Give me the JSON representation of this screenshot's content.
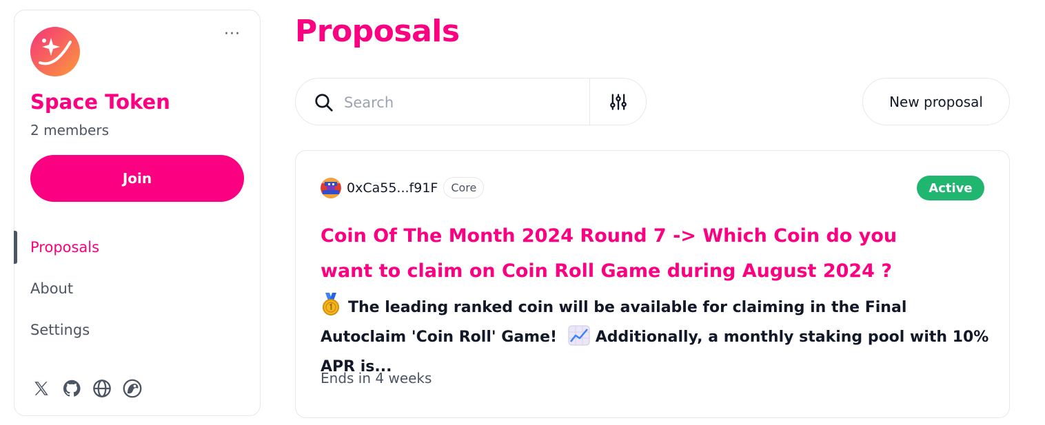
{
  "space": {
    "name": "Space Token",
    "members": "2 members",
    "join_label": "Join",
    "more_label": "···",
    "logo_icon": "space-token-logo",
    "nav": [
      {
        "label": "Proposals",
        "active": true
      },
      {
        "label": "About",
        "active": false
      },
      {
        "label": "Settings",
        "active": false
      }
    ],
    "socials": [
      "x-icon",
      "github-icon",
      "globe-icon",
      "coingecko-icon"
    ]
  },
  "main": {
    "title": "Proposals",
    "search": {
      "placeholder": "Search",
      "value": ""
    },
    "filter_icon": "filter-sliders-icon",
    "new_proposal_label": "New proposal"
  },
  "proposal": {
    "author": "0xCa55...f91F",
    "author_badge": "Core",
    "status": "Active",
    "title": "Coin Of The Month 2024 Round 7 -> Which Coin do you want to claim on Coin Roll Game during August 2024 ?",
    "body_part1": "The leading ranked coin will be available for claiming in the Final Autoclaim 'Coin Roll' Game!",
    "body_part2": "Additionally, a monthly staking pool with 10% APR is...",
    "ends": "Ends in 4 weeks"
  },
  "colors": {
    "brand": "#fb0080",
    "active": "#21b66f",
    "muted": "#4b5563",
    "border": "#e5e7eb"
  }
}
